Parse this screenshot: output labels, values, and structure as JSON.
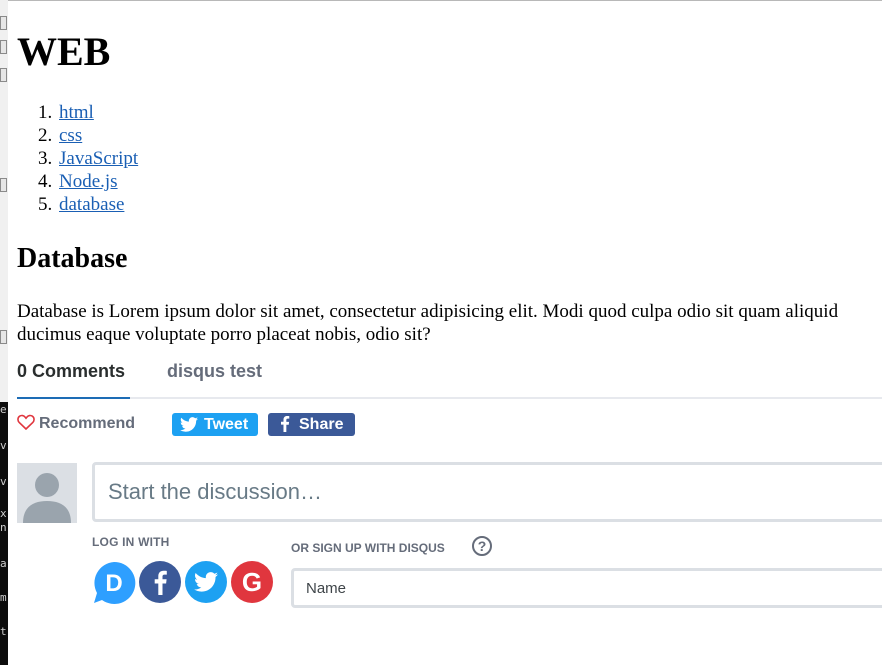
{
  "background_window": {
    "chars": [
      "e",
      "v",
      "v",
      "x",
      "n",
      "a",
      "m",
      "t"
    ]
  },
  "page": {
    "title": "WEB",
    "toc": [
      {
        "num": "1.",
        "label": "html"
      },
      {
        "num": "2.",
        "label": "css"
      },
      {
        "num": "3.",
        "label": "JavaScript"
      },
      {
        "num": "4.",
        "label": "Node.js"
      },
      {
        "num": "5.",
        "label": "database"
      }
    ],
    "section_title": "Database",
    "body_text": "Database is Lorem ipsum dolor sit amet, consectetur adipisicing elit. Modi quod culpa odio sit quam aliquid ducimus eaque voluptate porro placeat nobis, odio sit?"
  },
  "disqus": {
    "comments_tab": "0 Comments",
    "site_tab": "disqus test",
    "recommend_label": "Recommend",
    "tweet_label": "Tweet",
    "share_label": "Share",
    "comment_placeholder": "Start the discussion…",
    "login_label": "LOG IN WITH",
    "signup_label": "OR SIGN UP WITH DISQUS",
    "help_glyph": "?",
    "name_placeholder": "Name",
    "social_icons": [
      "disqus-icon",
      "facebook-icon",
      "twitter-icon",
      "google-icon"
    ]
  },
  "colors": {
    "link": "#1a5fb4",
    "tab_active_underline": "#1d6cb5",
    "twitter": "#1da1f2",
    "facebook": "#3b5998",
    "google": "#e0363e",
    "disqus": "#2e9fff",
    "muted_text": "#656c7a"
  }
}
